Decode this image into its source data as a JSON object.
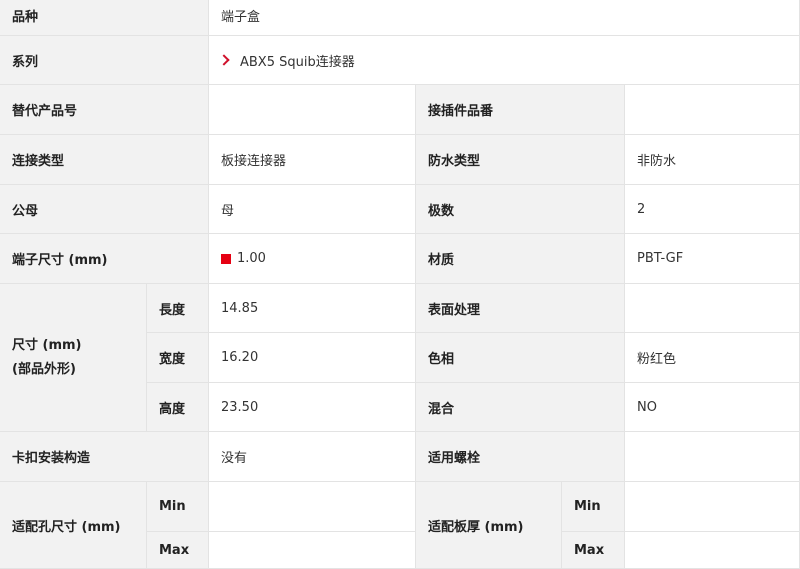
{
  "rows": {
    "product_type": {
      "label": "品种",
      "value": "端子盒"
    },
    "series": {
      "label": "系列",
      "value": "ABX5 Squib连接器"
    },
    "replacement": {
      "label": "替代产品号",
      "value": ""
    },
    "mating_part": {
      "label": "接插件品番",
      "value": ""
    },
    "connection_type": {
      "label": "连接类型",
      "value": "板接连接器"
    },
    "waterproof": {
      "label": "防水类型",
      "value": "非防水"
    },
    "gender": {
      "label": "公母",
      "value": "母"
    },
    "poles": {
      "label": "极数",
      "value": "2"
    },
    "terminal_size": {
      "label": "端子尺寸 (mm)",
      "value": "1.00",
      "swatch_color": "#e60012"
    },
    "material": {
      "label": "材质",
      "value": "PBT-GF"
    },
    "dimensions": {
      "label_line1": "尺寸 (mm)",
      "label_line2": "(部品外形)",
      "length": {
        "label": "長度",
        "value": "14.85"
      },
      "width": {
        "label": "宽度",
        "value": "16.20"
      },
      "height": {
        "label": "高度",
        "value": "23.50"
      }
    },
    "surface": {
      "label": "表面处理",
      "value": ""
    },
    "color": {
      "label": "色相",
      "value": "粉红色"
    },
    "mixing": {
      "label": "混合",
      "value": "NO"
    },
    "clip": {
      "label": "卡扣安装构造",
      "value": "没有"
    },
    "screw": {
      "label": "适用螺栓",
      "value": ""
    },
    "hole_size": {
      "label": "适配孔尺寸 (mm)",
      "min_label": "Min",
      "max_label": "Max",
      "min_value": "",
      "max_value": ""
    },
    "board_thickness": {
      "label": "适配板厚 (mm)",
      "min_label": "Min",
      "max_label": "Max",
      "min_value": "",
      "max_value": ""
    }
  },
  "colors": {
    "accent": "#d0112b",
    "label_bg": "#f2f2f2",
    "border": "#e3e3e3"
  }
}
